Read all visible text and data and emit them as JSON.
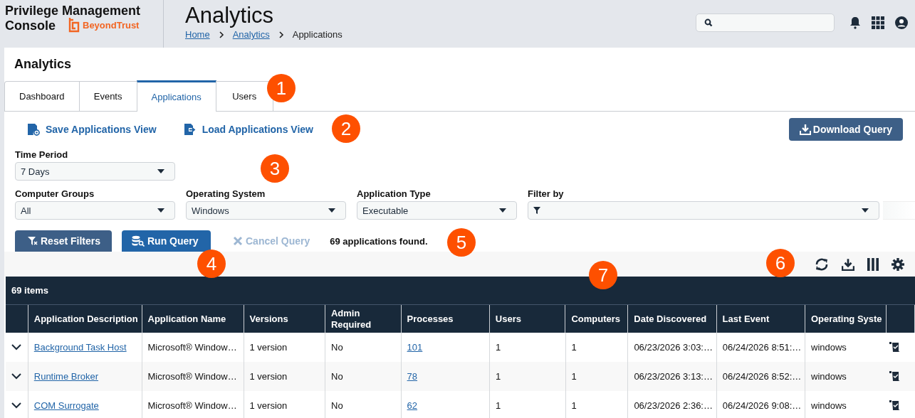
{
  "header": {
    "product_title": [
      "Privilege Management",
      "Console"
    ],
    "brand": "BeyondTrust",
    "page_title": "Analytics",
    "breadcrumb": [
      {
        "label": "Home",
        "link": true
      },
      {
        "label": "Analytics",
        "link": true
      },
      {
        "label": "Applications",
        "link": false
      }
    ]
  },
  "section_title": "Analytics",
  "tabs": [
    {
      "label": "Dashboard",
      "selected": false
    },
    {
      "label": "Events",
      "selected": false
    },
    {
      "label": "Applications",
      "selected": true
    },
    {
      "label": "Users",
      "selected": false
    }
  ],
  "view_actions": [
    {
      "label": "Save Applications View",
      "kind": "save"
    },
    {
      "label": "Load Applications View",
      "kind": "load"
    }
  ],
  "download_button": "Download Query",
  "time_period": {
    "label": "Time Period",
    "value": "7 Days"
  },
  "filters": [
    {
      "label": "Computer Groups",
      "value": "All"
    },
    {
      "label": "Operating System",
      "value": "Windows"
    },
    {
      "label": "Application Type",
      "value": "Executable"
    }
  ],
  "filter_by": {
    "label": "Filter by"
  },
  "buttons": [
    {
      "label": "Reset Filters",
      "kind": "reset",
      "disabled": false
    },
    {
      "label": "Run Query",
      "kind": "run",
      "disabled": false
    },
    {
      "label": "Cancel Query",
      "kind": "cancel",
      "disabled": true
    }
  ],
  "result_text": "69 applications found.",
  "grid": {
    "items_count": "69 items",
    "columns": [
      {
        "kind": "expander"
      },
      {
        "label": "Application Description",
        "kind": "link"
      },
      {
        "label": "Application Name",
        "kind": "text"
      },
      {
        "label": "Versions",
        "kind": "text"
      },
      {
        "label": "Admin Required",
        "kind": "text"
      },
      {
        "label": "Processes",
        "kind": "link"
      },
      {
        "label": "Users",
        "kind": "text"
      },
      {
        "label": "Computers",
        "kind": "text"
      },
      {
        "label": "Date Discovered",
        "kind": "text"
      },
      {
        "label": "Last Event",
        "kind": "text"
      },
      {
        "label": "Operating Syste",
        "kind": "text"
      },
      {
        "kind": "action"
      }
    ],
    "rows": [
      {
        "cells": [
          null,
          "Background Task Host",
          "Microsoft® Window…",
          "1 version",
          "No",
          "101",
          "1",
          "1",
          "06/23/2026 3:03:…",
          "06/24/2026 8:51:…",
          "windows",
          null
        ]
      },
      {
        "cells": [
          null,
          "Runtime Broker",
          "Microsoft® Window…",
          "1 version",
          "No",
          "78",
          "1",
          "1",
          "06/23/2026 3:13:…",
          "06/24/2026 8:52:…",
          "windows",
          null
        ]
      },
      {
        "cells": [
          null,
          "COM Surrogate",
          "Microsoft® Window…",
          "1 version",
          "No",
          "62",
          "1",
          "1",
          "06/23/2026 2:36:…",
          "06/24/2026 9:08:…",
          "windows",
          null
        ]
      }
    ]
  },
  "callouts": [
    "1",
    "2",
    "3",
    "4",
    "5",
    "6",
    "7"
  ]
}
